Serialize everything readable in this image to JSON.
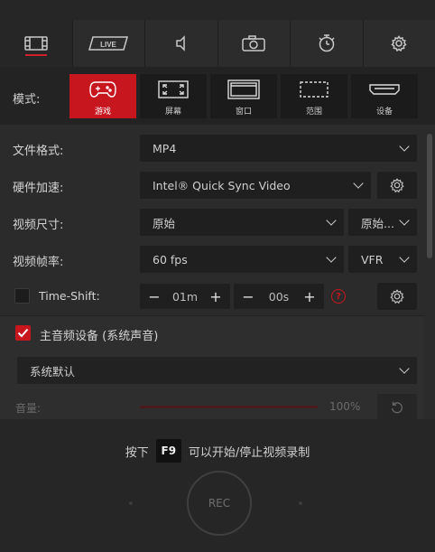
{
  "tabs": [
    {
      "name": "video-icon",
      "active": true
    },
    {
      "name": "live-icon",
      "label": "LIVE",
      "active": false
    },
    {
      "name": "audio-icon",
      "active": false
    },
    {
      "name": "camera-icon",
      "active": false
    },
    {
      "name": "timer-icon",
      "active": false
    },
    {
      "name": "gear-icon",
      "active": false
    }
  ],
  "mode": {
    "label": "模式:",
    "buttons": [
      {
        "label": "游戏",
        "icon": "gamepad-icon",
        "active": true
      },
      {
        "label": "屏幕",
        "icon": "fullscreen-icon",
        "active": false
      },
      {
        "label": "窗口",
        "icon": "window-icon",
        "active": false
      },
      {
        "label": "范围",
        "icon": "region-icon",
        "active": false
      },
      {
        "label": "设备",
        "icon": "hdmi-device-icon",
        "active": false
      }
    ]
  },
  "settings": {
    "file_format": {
      "label": "文件格式:",
      "value": "MP4"
    },
    "hw_accel": {
      "label": "硬件加速:",
      "value": "Intel® Quick Sync Video"
    },
    "video_size": {
      "label": "视频尺寸:",
      "value": "原始",
      "value2": "原始..."
    },
    "frame_rate": {
      "label": "视频帧率:",
      "value": "60 fps",
      "value2": "VFR"
    },
    "timeshift": {
      "label": "Time-Shift:",
      "checked": false,
      "minutes": "01m",
      "seconds": "00s",
      "minus": "−",
      "plus": "+",
      "help": "?"
    }
  },
  "audio": {
    "main_device_label": "主音频设备 (系统声音)",
    "main_device_checked": true,
    "device_value": "系统默认",
    "volume_label": "音量:",
    "volume_value": "100%",
    "volume_level": 1.0
  },
  "footer": {
    "hint_prefix": "按下",
    "hotkey": "F9",
    "hint_suffix": "可以开始/停止视频录制",
    "rec_label": "REC"
  },
  "colors": {
    "accent": "#c8161f",
    "bg": "#2b2b2b"
  }
}
